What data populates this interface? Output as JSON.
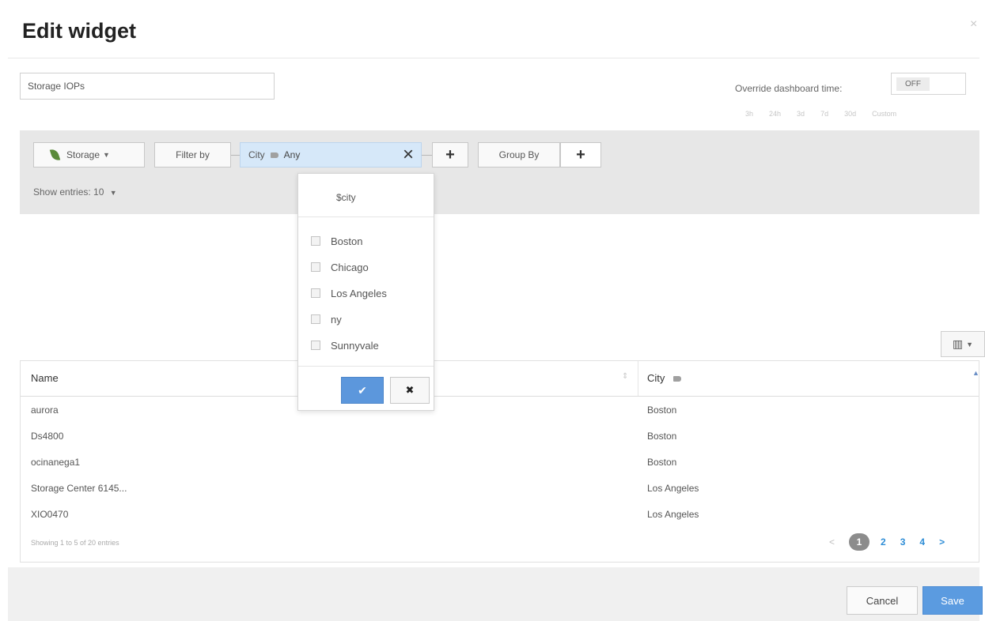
{
  "dialog": {
    "title": "Edit widget",
    "close_label": "×"
  },
  "widget_name": {
    "value": "Storage IOPs",
    "placeholder": ""
  },
  "override": {
    "label": "Override dashboard time:",
    "toggle_value": "OFF",
    "ranges": [
      "3h",
      "24h",
      "3d",
      "7d",
      "30d",
      "Custom"
    ]
  },
  "query": {
    "object_type": "Storage",
    "filter_by_label": "Filter by",
    "filter": {
      "field": "City",
      "value": "Any",
      "clear_icon": "×"
    },
    "add_label": "+",
    "group_by_label": "Group By",
    "show_entries": "Show entries: 10"
  },
  "city_dropdown": {
    "search_text": "$city",
    "options": [
      "Boston",
      "Chicago",
      "Los Angeles",
      "ny",
      "Sunnyvale"
    ],
    "ok_icon": "✔",
    "cancel_icon": "✖"
  },
  "table": {
    "columns": [
      "Name",
      "City"
    ],
    "rows": [
      {
        "name": "aurora",
        "city": "Boston"
      },
      {
        "name": "Ds4800",
        "city": "Boston"
      },
      {
        "name": "ocinanega1",
        "city": "Boston"
      },
      {
        "name": "Storage Center 6145...",
        "city": "Los Angeles"
      },
      {
        "name": "XIO0470",
        "city": "Los Angeles"
      }
    ],
    "showing": "Showing 1 to 5 of 20 entries",
    "pagination": {
      "prev": "<",
      "pages": [
        "1",
        "2",
        "3",
        "4"
      ],
      "next": ">"
    }
  },
  "footer": {
    "cancel": "Cancel",
    "save": "Save"
  }
}
